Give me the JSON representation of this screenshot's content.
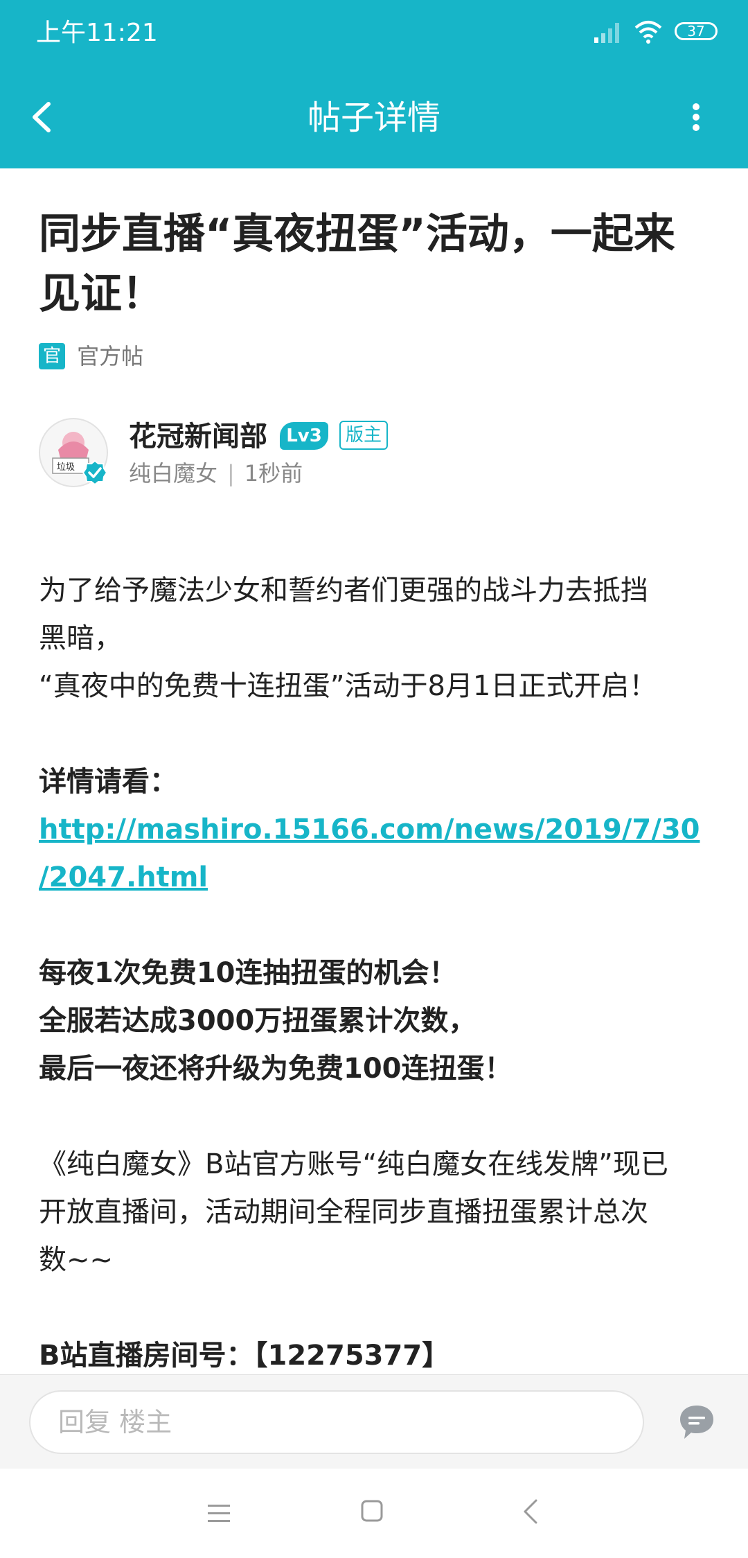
{
  "status_bar": {
    "time": "上午11:21",
    "battery": "37"
  },
  "app_bar": {
    "title": "帖子详情"
  },
  "post": {
    "title": "同步直播“真夜扭蛋”活动，一起来见证！",
    "official_badge": "官",
    "official_label": "官方帖",
    "author": {
      "name": "花冠新闻部",
      "level": "Lv3",
      "role": "版主",
      "avatar_caption": "垃圾",
      "forum": "纯白魔女",
      "time": "1秒前"
    },
    "body": [
      {
        "text": "为了给予魔法少女和誓约者们更强的战斗力去抵挡",
        "style": "normal"
      },
      {
        "text": "黑暗，",
        "style": "normal"
      },
      {
        "text": "“真夜中的免费十连扭蛋”活动于8月1日正式开启！",
        "style": "normal"
      },
      {
        "text": "",
        "style": "normal"
      },
      {
        "text": "详情请看：",
        "style": "bold"
      },
      {
        "text": "http://mashiro.15166.com/news/2019/7/30",
        "style": "link"
      },
      {
        "text": "/2047.html",
        "style": "link"
      },
      {
        "text": "",
        "style": "normal"
      },
      {
        "text": "每夜1次免费10连抽扭蛋的机会！",
        "style": "bold"
      },
      {
        "text": "全服若达成3000万扭蛋累计次数，",
        "style": "bold"
      },
      {
        "text": "最后一夜还将升级为免费100连扭蛋！",
        "style": "bold"
      },
      {
        "text": "",
        "style": "normal"
      },
      {
        "text": "《纯白魔女》B站官方账号“纯白魔女在线发牌”现已",
        "style": "normal"
      },
      {
        "text": "开放直播间，活动期间全程同步直播扭蛋累计总次",
        "style": "normal"
      },
      {
        "text": "数~~",
        "style": "normal"
      },
      {
        "text": "",
        "style": "normal"
      },
      {
        "text": "B站直播房间号：【12275377】",
        "style": "bold"
      }
    ]
  },
  "reply": {
    "placeholder": "回复  楼主"
  },
  "colors": {
    "accent": "#17b5c8",
    "text": "#222222",
    "muted": "#888888"
  }
}
